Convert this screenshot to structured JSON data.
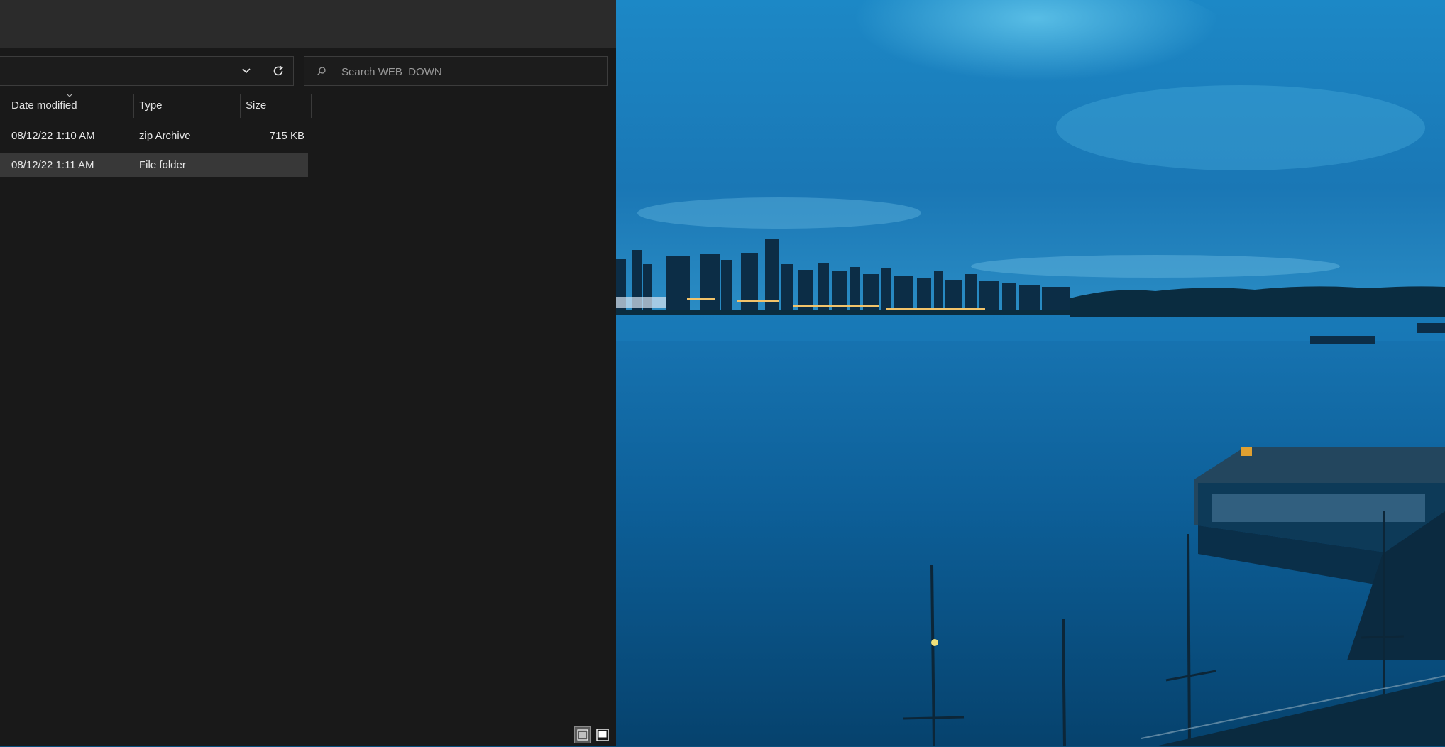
{
  "explorer": {
    "search": {
      "placeholder": "Search WEB_DOWN"
    },
    "columns": [
      {
        "label": "Date modified"
      },
      {
        "label": "Type"
      },
      {
        "label": "Size"
      }
    ],
    "rows": [
      {
        "date": "08/12/22 1:10 AM",
        "type": "zip Archive",
        "size": "715 KB"
      },
      {
        "date": "08/12/22 1:11 AM",
        "type": "File folder",
        "size": ""
      }
    ],
    "icons": {
      "chevron": "chevron-down-icon",
      "refresh": "refresh-icon",
      "search": "search-icon",
      "details_view": "details-view-icon",
      "tiles_view": "large-icons-view-icon"
    }
  },
  "colors": {
    "explorer_bg": "#191919",
    "selected_row": "#383838",
    "sky": "#1a7fc0",
    "water": "#0b5a8f"
  }
}
